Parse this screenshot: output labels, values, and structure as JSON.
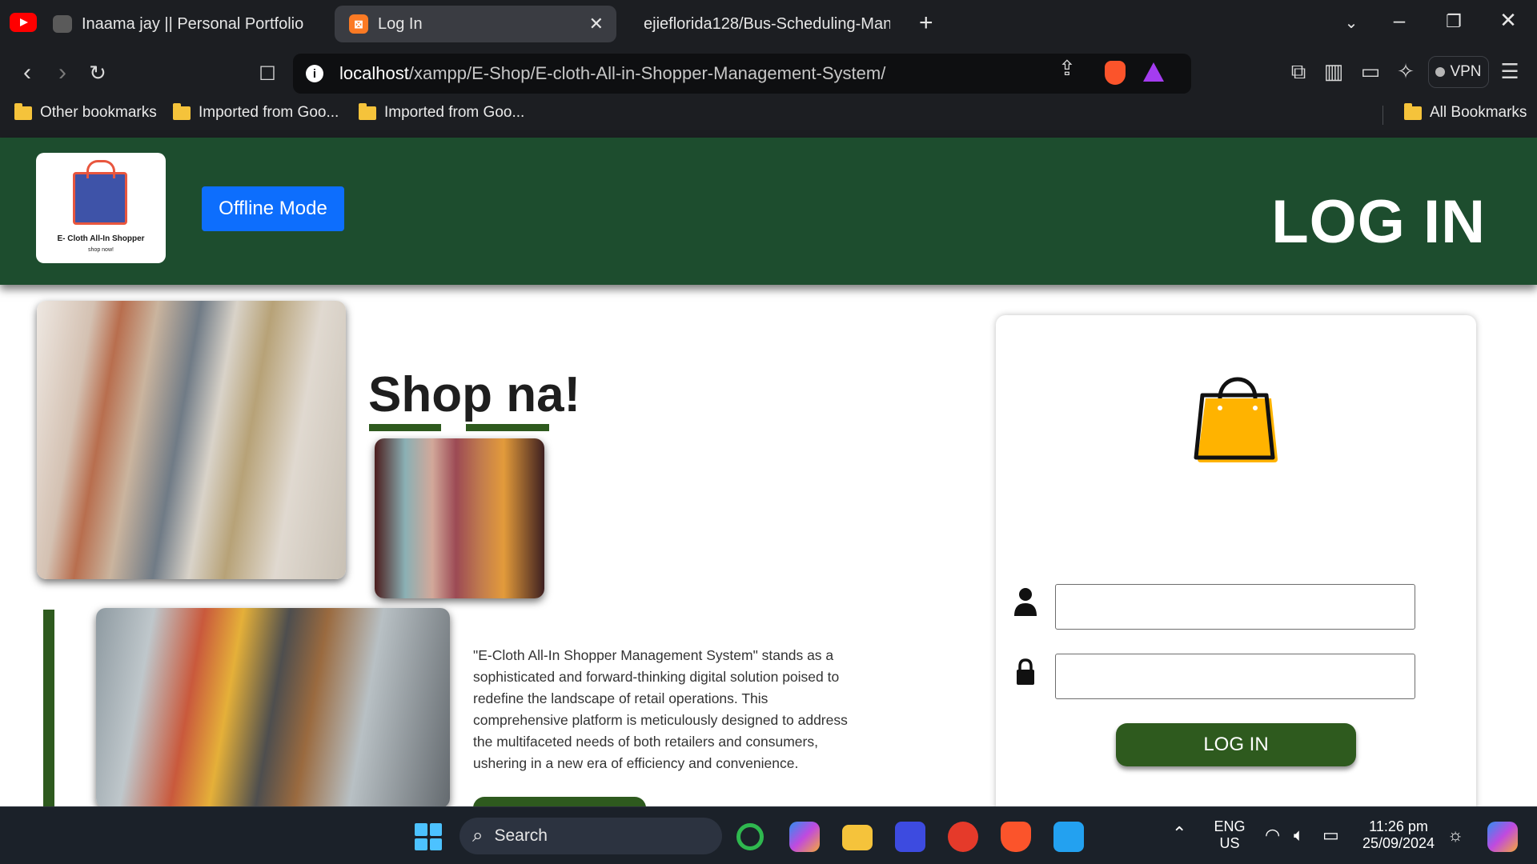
{
  "browser": {
    "tabs": [
      {
        "title": "Inaama jay || Personal Portfolio"
      },
      {
        "title": "Log In"
      },
      {
        "title": "ejieflorida128/Bus-Scheduling-Mana"
      }
    ],
    "url_host": "localhost",
    "url_path": "/xampp/E-Shop/E-cloth-All-in-Shopper-Management-System/",
    "vpn_label": "VPN",
    "bookmarks": [
      "Other bookmarks",
      "Imported from Goo...",
      "Imported from Goo..."
    ],
    "all_bookmarks": "All Bookmarks"
  },
  "header": {
    "logo_title": "E- Cloth All-In Shopper",
    "logo_sub": "shop now!",
    "offline_label": "Offline Mode",
    "title": "LOG IN"
  },
  "main": {
    "heading": "Shop na!",
    "description": "\"E-Cloth All-In Shopper Management System\" stands as a sophisticated and forward-thinking digital solution poised to redefine the landscape of retail operations. This comprehensive platform is meticulously designed to address the multifaceted needs of both retailers and consumers, ushering in a new era of efficiency and convenience."
  },
  "login": {
    "username_value": "",
    "password_value": "",
    "button_label": "LOG IN"
  },
  "taskbar": {
    "search_label": "Search",
    "lang_top": "ENG",
    "lang_bottom": "US",
    "time": "11:26 pm",
    "date": "25/09/2024"
  },
  "colors": {
    "header_green": "#1d4d2e",
    "accent_green": "#2e5a1e",
    "offline_blue": "#0d6efd",
    "bag_yellow": "#ffb300"
  }
}
